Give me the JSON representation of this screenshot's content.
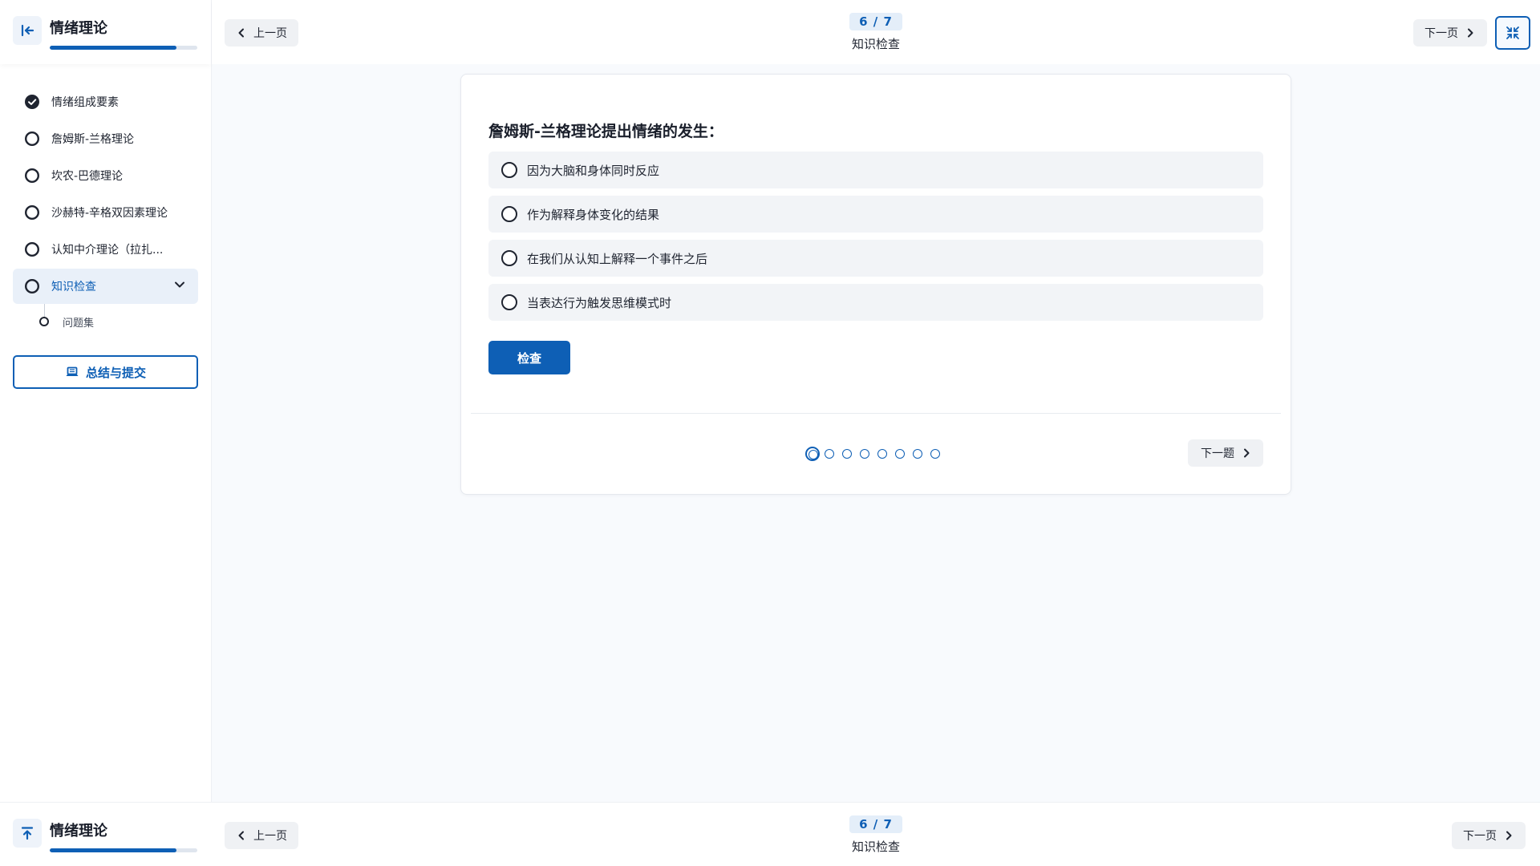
{
  "app": {
    "title": "情绪理论",
    "progress_percent": 86
  },
  "sidebar": {
    "items": [
      {
        "label": "情绪组成要素",
        "status": "completed"
      },
      {
        "label": "詹姆斯-兰格理论",
        "status": "incomplete"
      },
      {
        "label": "坎农-巴德理论",
        "status": "incomplete"
      },
      {
        "label": "沙赫特-辛格双因素理论",
        "status": "incomplete"
      },
      {
        "label": "认知中介理论（拉扎...",
        "status": "incomplete"
      },
      {
        "label": "知识检查",
        "status": "active"
      }
    ],
    "sub_items": [
      {
        "label": "问题集"
      }
    ],
    "submit_label": "总结与提交"
  },
  "header": {
    "prev_label": "上一页",
    "next_label": "下一页",
    "page_indicator": "6 / 7",
    "page_title": "知识检查"
  },
  "quiz": {
    "question": "詹姆斯-兰格理论提出情绪的发生：",
    "options": [
      "因为大脑和身体同时反应",
      "作为解释身体变化的结果",
      "在我们从认知上解释一个事件之后",
      "当表达行为触发思维模式时"
    ],
    "check_label": "检查",
    "next_question_label": "下一题",
    "total_questions": 8,
    "current_question": 1
  },
  "footer": {
    "prev_label": "上一页",
    "next_label": "下一页",
    "page_indicator": "6 / 7",
    "page_title": "知识检查"
  },
  "colors": {
    "accent": "#0e5fb5",
    "accent_light": "#e4eef9",
    "button_gray": "#eff1f4"
  }
}
